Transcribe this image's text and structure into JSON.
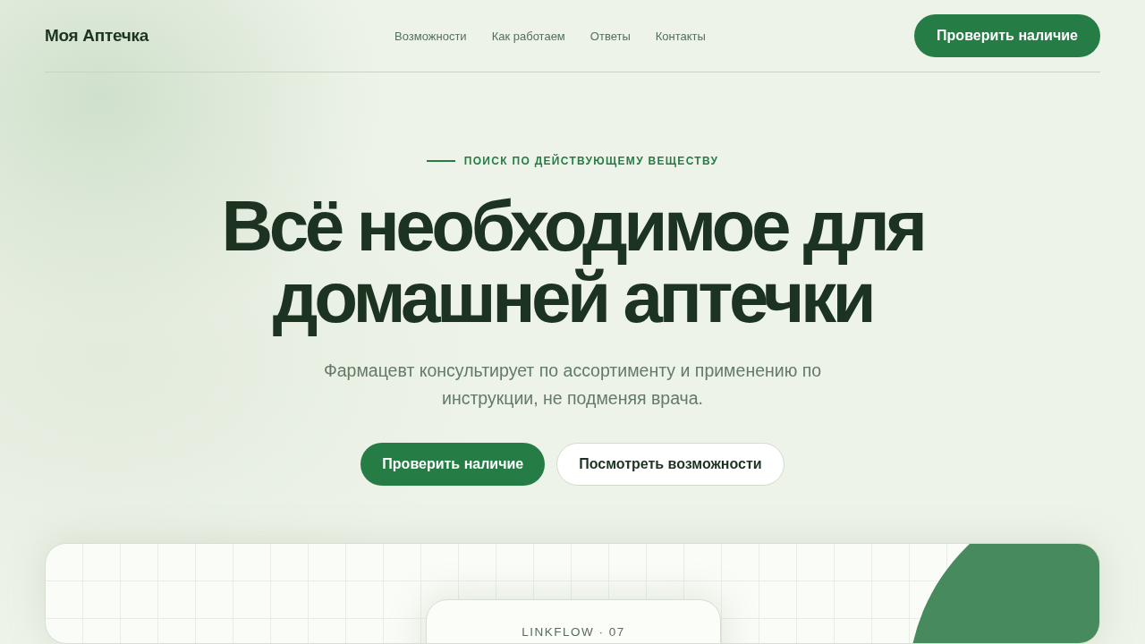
{
  "header": {
    "logo": "Моя Аптечка",
    "nav": [
      "Возможности",
      "Как работаем",
      "Ответы",
      "Контакты"
    ],
    "cta": "Проверить наличие"
  },
  "hero": {
    "eyebrow": "ПОИСК ПО ДЕЙСТВУЮЩЕМУ ВЕЩЕСТВУ",
    "title": "Всё необходимое для домашней аптечки",
    "subtitle": "Фармацевт консультирует по ассортименту и применению по инструкции, не подменяя врача.",
    "buttons": [
      {
        "label": "Проверить наличие",
        "kind": "primary"
      },
      {
        "label": "Посмотреть возможности",
        "kind": "secondary"
      }
    ]
  },
  "showcase": {
    "card_label": "LINKFLOW · 07"
  }
}
